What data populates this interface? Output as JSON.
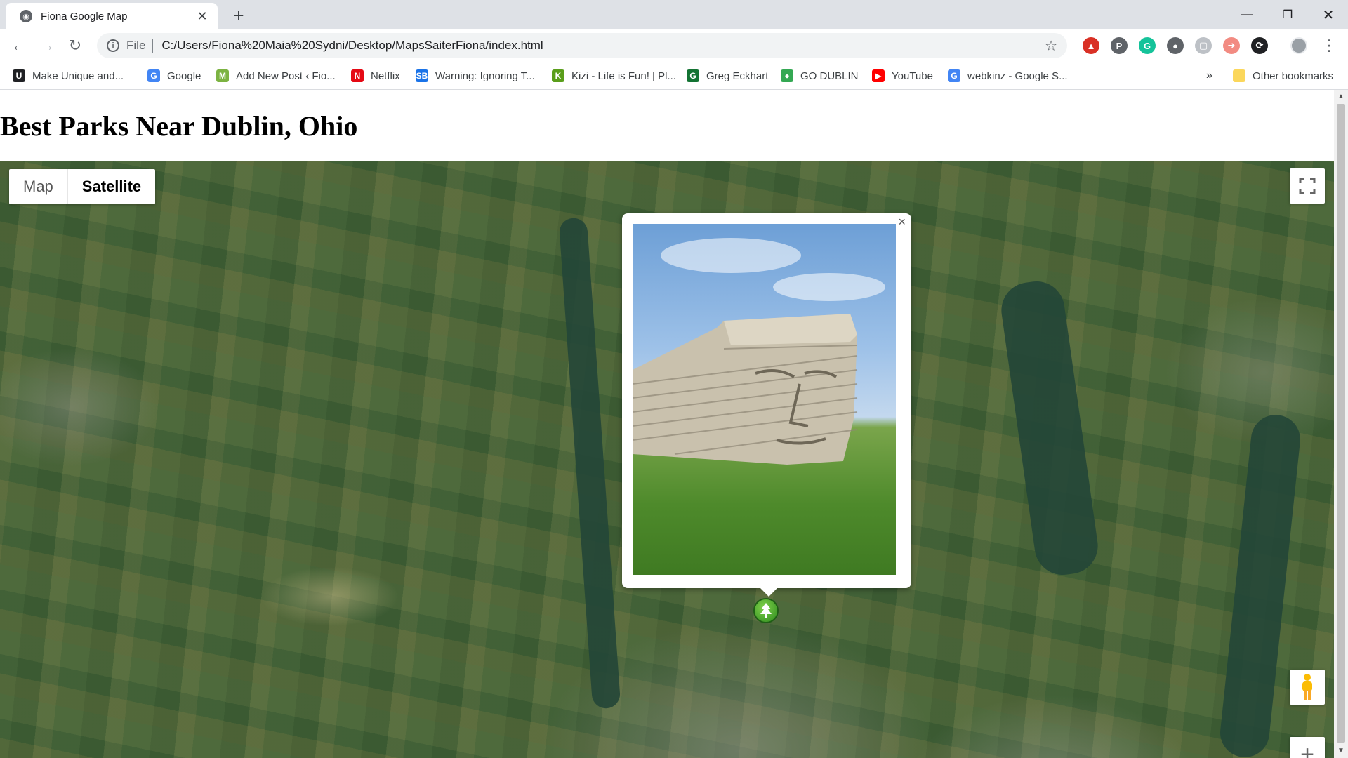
{
  "browser": {
    "tab_title": "Fiona Google Map",
    "tab_close": "✕",
    "new_tab": "+",
    "window_controls": {
      "minimize": "—",
      "restore": "❐",
      "close": "✕"
    },
    "nav": {
      "back": "←",
      "forward": "→",
      "reload": "↻"
    },
    "address": {
      "info": "i",
      "scheme": "File",
      "url": "C:/Users/Fiona%20Maia%20Sydni/Desktop/MapsSaiterFiona/index.html",
      "star": "☆"
    },
    "extensions": [
      {
        "icon": "red-extension-icon",
        "color": "#d93025",
        "glyph": "▲"
      },
      {
        "icon": "pinterest-icon",
        "color": "#5f6368",
        "glyph": "P"
      },
      {
        "icon": "grammarly-icon",
        "color": "#15c39a",
        "glyph": "G"
      },
      {
        "icon": "circle-extension-icon",
        "color": "#5f6368",
        "glyph": "●"
      },
      {
        "icon": "page-extension-icon",
        "color": "#bdc1c6",
        "glyph": "▢"
      },
      {
        "icon": "arrow-extension-icon",
        "color": "#f28b82",
        "glyph": "➜"
      },
      {
        "icon": "refresh-extension-icon",
        "color": "#202124",
        "glyph": "⟳"
      }
    ],
    "menu": "⋮"
  },
  "bookmarks": {
    "items": [
      {
        "label": "Make Unique and...",
        "icon": "make-unique-icon",
        "color": "#202124",
        "glyph": "U"
      },
      {
        "label": "Google",
        "icon": "google-icon",
        "color": "#4285f4",
        "glyph": "G"
      },
      {
        "label": "Add New Post ‹ Fio...",
        "icon": "add-post-icon",
        "color": "#7cb342",
        "glyph": "M"
      },
      {
        "label": "Netflix",
        "icon": "netflix-icon",
        "color": "#e50914",
        "glyph": "N"
      },
      {
        "label": "Warning: Ignoring T...",
        "icon": "sb-icon",
        "color": "#1a73e8",
        "glyph": "SB"
      },
      {
        "label": "Kizi - Life is Fun! | Pl...",
        "icon": "kizi-icon",
        "color": "#5a9e1b",
        "glyph": "K"
      },
      {
        "label": "Greg Eckhart",
        "icon": "greg-eckhart-icon",
        "color": "#137333",
        "glyph": "G"
      },
      {
        "label": "GO DUBLIN",
        "icon": "go-dublin-icon",
        "color": "#34a853",
        "glyph": "●"
      },
      {
        "label": "YouTube",
        "icon": "youtube-icon",
        "color": "#ff0000",
        "glyph": "▶"
      },
      {
        "label": "webkinz - Google S...",
        "icon": "google-icon",
        "color": "#4285f4",
        "glyph": "G"
      }
    ],
    "overflow": "»",
    "other": {
      "label": "Other bookmarks",
      "icon": "folder-icon",
      "color": "#fbd75b"
    }
  },
  "page": {
    "title": "Best Parks Near Dublin, Ohio"
  },
  "map": {
    "type_map": "Map",
    "type_satellite": "Satellite",
    "selected_type": "Satellite",
    "fullscreen_icon": "fullscreen-icon",
    "pegman_icon": "pegman-icon",
    "zoom_in": "+",
    "infowindow_close": "×",
    "marker_icon": "park-tree-icon"
  }
}
